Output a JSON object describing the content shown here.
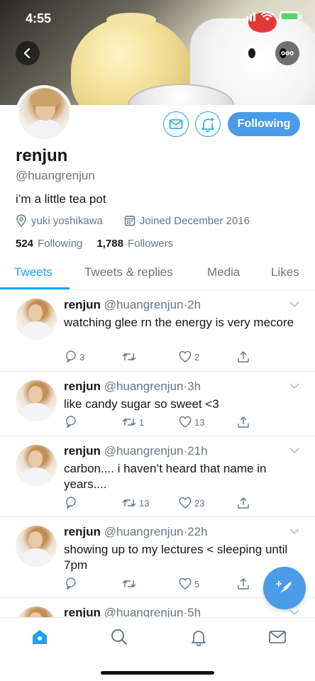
{
  "status_bar": {
    "time": "4:55"
  },
  "profile": {
    "name": "renjun",
    "handle": "@huangrenjun",
    "bio": "i’m a little tea pot",
    "location": "yuki yoshikawa",
    "joined": "Joined December 2016",
    "following_count": "524",
    "following_label": "Following",
    "followers_count": "1,788",
    "followers_label": "Followers",
    "follow_button": "Following"
  },
  "tabs": [
    {
      "label": "Tweets",
      "active": true
    },
    {
      "label": "Tweets & replies",
      "active": false
    },
    {
      "label": "Media",
      "active": false
    },
    {
      "label": "Likes",
      "active": false
    }
  ],
  "tweets": [
    {
      "name": "renjun",
      "handle": "@huangrenjun",
      "time": "2h",
      "text": "watching glee rn the energy is very mecore",
      "replies": "3",
      "retweets": "",
      "likes": "2"
    },
    {
      "name": "renjun",
      "handle": "@huangrenjun",
      "time": "3h",
      "text": "like candy sugar so sweet <3",
      "replies": "",
      "retweets": "1",
      "likes": "13"
    },
    {
      "name": "renjun",
      "handle": "@huangrenjun",
      "time": "21h",
      "text": "carbon.... i haven’t heard that name in years....",
      "replies": "",
      "retweets": "13",
      "likes": "23"
    },
    {
      "name": "renjun",
      "handle": "@huangrenjun",
      "time": "22h",
      "text": "showing up to my lectures < sleeping until 7pm",
      "replies": "",
      "retweets": "",
      "likes": "5"
    },
    {
      "name": "renjun",
      "handle": "@huangrenjun",
      "time": "5h",
      "text": "",
      "replies": "",
      "retweets": "",
      "likes": ""
    }
  ],
  "colors": {
    "accent": "#1da1f2",
    "button": "#4a9ce8",
    "muted": "#657786"
  },
  "icons": {
    "back": "chevron-left-icon",
    "more": "more-icon",
    "mail": "mail-icon",
    "notif": "bell-plus-icon",
    "location": "location-pin-icon",
    "calendar": "calendar-icon",
    "reply": "reply-icon",
    "retweet": "retweet-icon",
    "like": "heart-icon",
    "share": "share-icon",
    "compose": "compose-icon",
    "home": "home-icon",
    "search": "search-icon",
    "notifications": "bell-icon",
    "messages": "mail-icon"
  }
}
